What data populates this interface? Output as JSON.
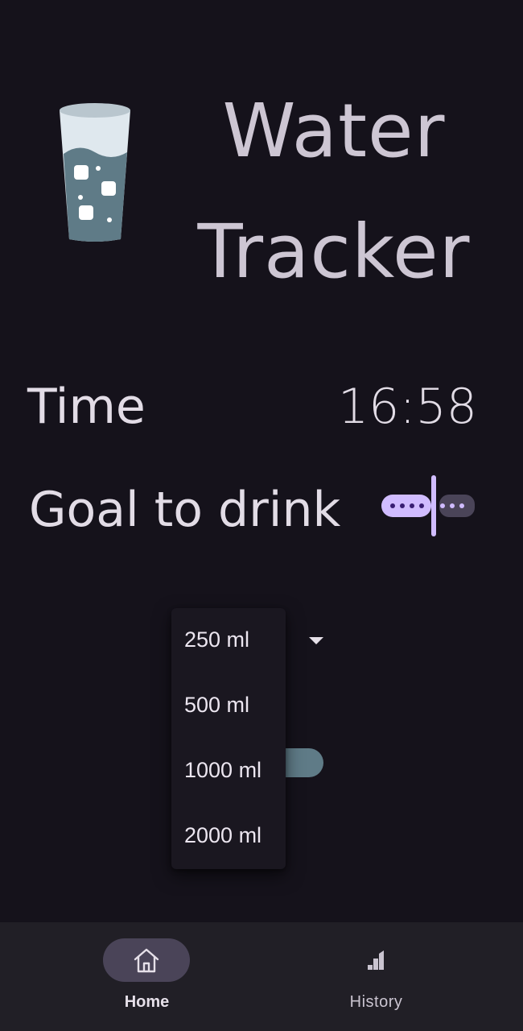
{
  "header": {
    "title_line1": "Water",
    "title_line2": "Tracker",
    "logo_icon": "water-glass-icon"
  },
  "time": {
    "label": "Time",
    "value": "16:58"
  },
  "goal": {
    "label": "Goal to drink",
    "slider_icon": "slider-icon"
  },
  "dropdown": {
    "selected": "250 ml",
    "options": [
      "250 ml",
      "500 ml",
      "1000 ml",
      "2000 ml"
    ]
  },
  "nav": {
    "items": [
      {
        "label": "Home",
        "icon": "home-icon",
        "active": true
      },
      {
        "label": "History",
        "icon": "signal-bars-icon",
        "active": false
      }
    ]
  },
  "colors": {
    "background": "#15121b",
    "accent": "#d0bcff",
    "water": "#5f7b87",
    "nav_background": "#211f26",
    "active_pill": "#4a4458"
  }
}
